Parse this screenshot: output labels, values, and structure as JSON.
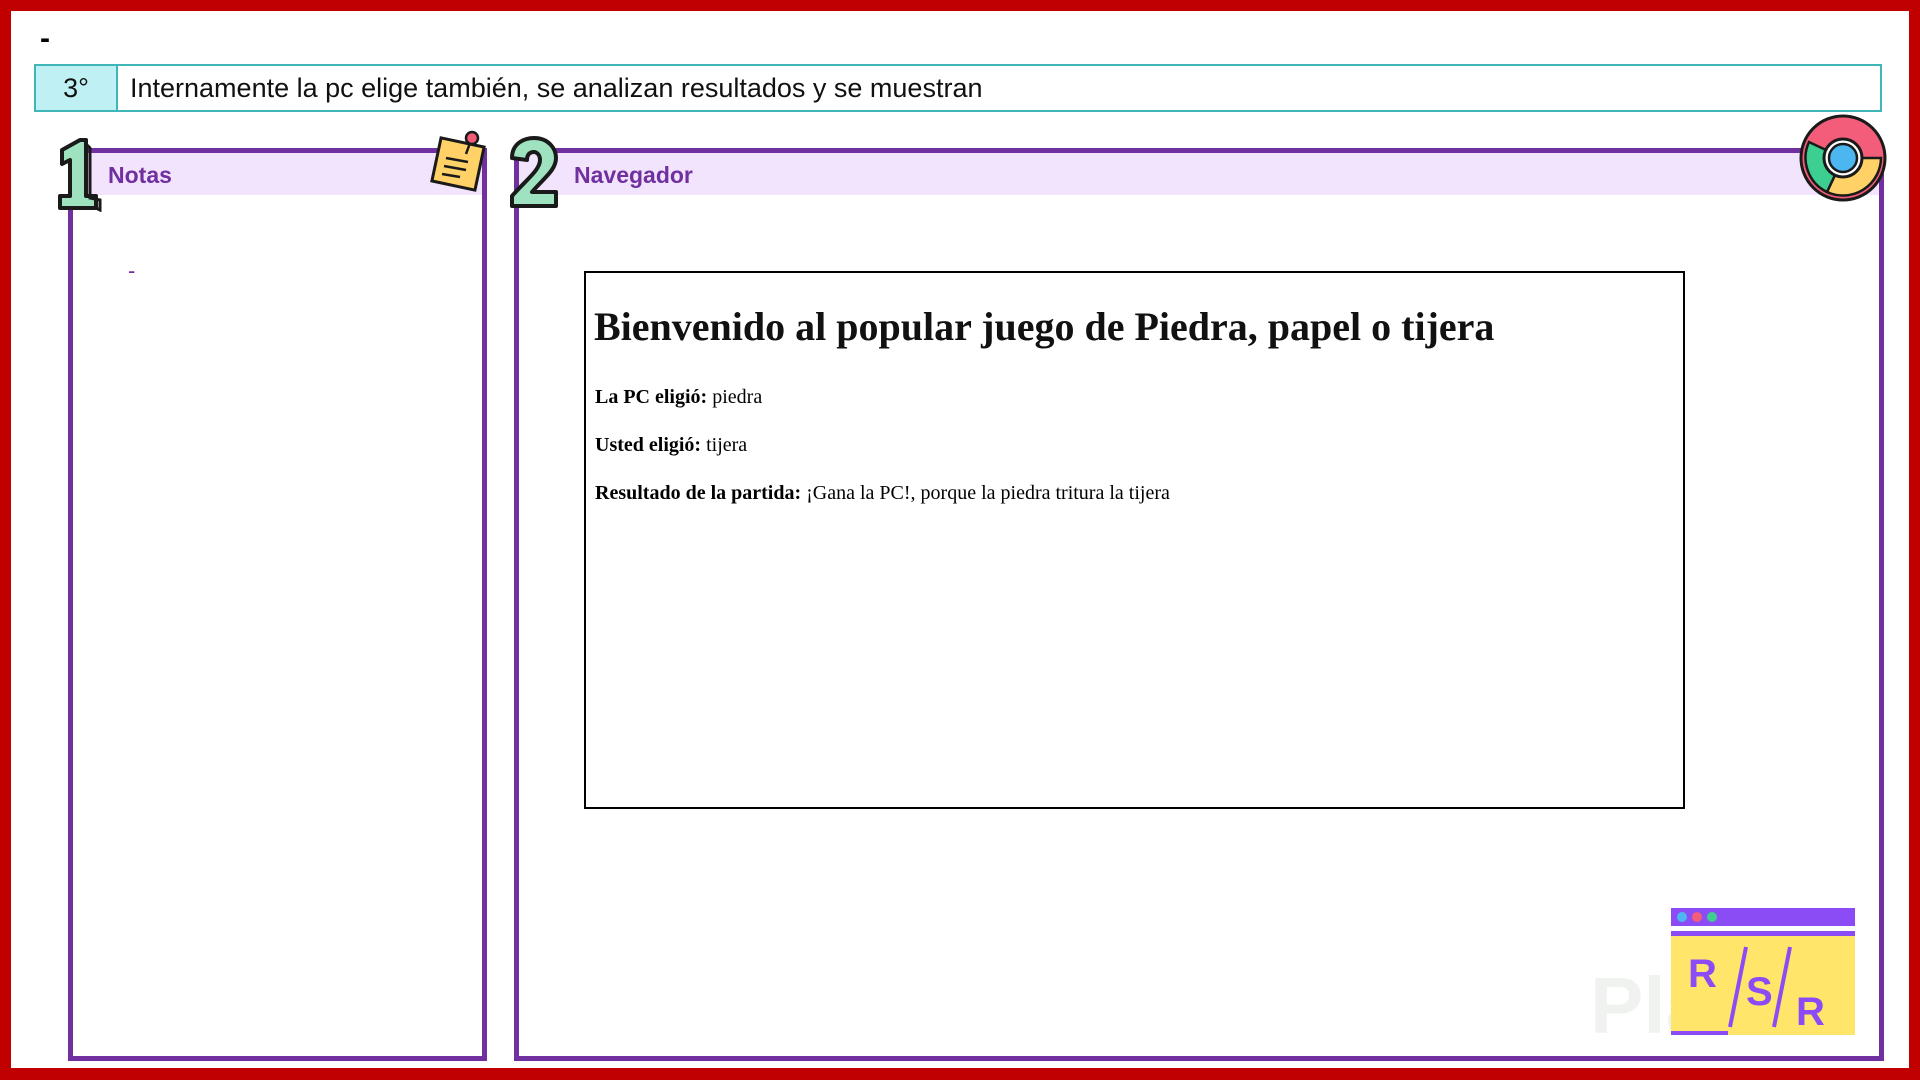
{
  "top_marker": "-",
  "step": {
    "number": "3°",
    "text": "Internamente la pc elige también, se analizan resultados y se muestran"
  },
  "notes_panel": {
    "badge": "1",
    "title": "Notas",
    "content": "-"
  },
  "browser_panel": {
    "badge": "2",
    "title": "Navegador",
    "page": {
      "heading": "Bienvenido al popular juego de Piedra, papel o tijera",
      "pc_choice": {
        "label": "La PC eligió:",
        "value": " piedra"
      },
      "user_choice": {
        "label": "Usted eligió:",
        "value": " tijera"
      },
      "result": {
        "label": "Resultado de la partida:",
        "value": " ¡Gana la PC!, porque la piedra tritura la tijera"
      }
    }
  },
  "logo": {
    "letters": [
      "R",
      "S",
      "R"
    ]
  },
  "watermark": "Platzi",
  "colors": {
    "frame": "#c00000",
    "panel_border": "#7030a0",
    "panel_header": "#f1e4fc",
    "step_border": "#3fb7b9",
    "step_fill": "#bff0f3",
    "badge_green": "#9fe2bf",
    "logo_yellow": "#ffe66a",
    "logo_purple": "#8b4cf5"
  },
  "icons": {
    "notes": "sticky-note-icon",
    "browser": "chrome-icon",
    "badge1": "number-1-icon",
    "badge2": "number-2-icon",
    "logo": "rsr-logo-icon"
  }
}
